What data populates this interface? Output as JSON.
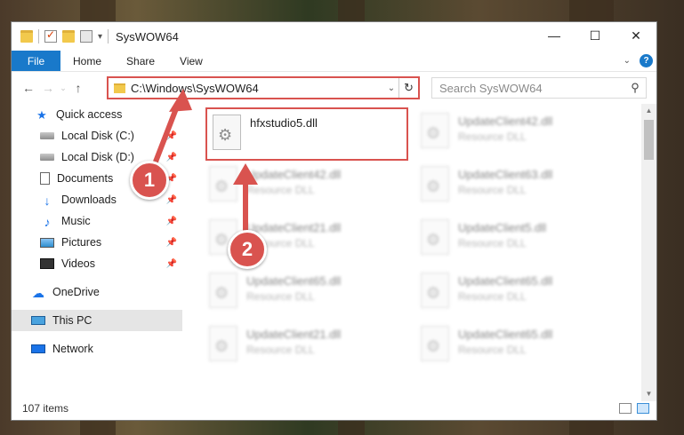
{
  "window": {
    "title": "SysWOW64"
  },
  "ribbon": {
    "tabs": [
      "File",
      "Home",
      "Share",
      "View"
    ],
    "help": "?"
  },
  "address": {
    "path": "C:\\Windows\\SysWOW64",
    "refresh_icon": "refresh-icon"
  },
  "search": {
    "placeholder": "Search SysWOW64"
  },
  "sidebar": {
    "items": [
      {
        "label": "Quick access",
        "icon": "star-icon",
        "pinned": false
      },
      {
        "label": "Local Disk (C:)",
        "icon": "disk-icon",
        "pinned": true
      },
      {
        "label": "Local Disk (D:)",
        "icon": "disk-icon",
        "pinned": true
      },
      {
        "label": "Documents",
        "icon": "document-icon",
        "pinned": true
      },
      {
        "label": "Downloads",
        "icon": "download-icon",
        "pinned": true
      },
      {
        "label": "Music",
        "icon": "music-icon",
        "pinned": true
      },
      {
        "label": "Pictures",
        "icon": "pictures-icon",
        "pinned": true
      },
      {
        "label": "Videos",
        "icon": "video-icon",
        "pinned": true
      },
      {
        "label": "OneDrive",
        "icon": "cloud-icon",
        "pinned": false
      },
      {
        "label": "This PC",
        "icon": "pc-icon",
        "pinned": false,
        "selected": true
      },
      {
        "label": "Network",
        "icon": "network-icon",
        "pinned": false
      }
    ]
  },
  "files": [
    {
      "name": "hfxstudio5.dll",
      "type": ""
    },
    {
      "name": "UpdateClient42.dll",
      "type": "Resource DLL"
    },
    {
      "name": "UpdateClient42.dll",
      "type": "Resource DLL"
    },
    {
      "name": "UpdateClient63.dll",
      "type": "Resource DLL"
    },
    {
      "name": "UpdateClient21.dll",
      "type": "Resource DLL"
    },
    {
      "name": "UpdateClient5.dll",
      "type": "Resource DLL"
    },
    {
      "name": "UpdateClient65.dll",
      "type": "Resource DLL"
    },
    {
      "name": "UpdateClient65.dll",
      "type": "Resource DLL"
    },
    {
      "name": "UpdateClient21.dll",
      "type": "Resource DLL"
    },
    {
      "name": "UpdateClient65.dll",
      "type": "Resource DLL"
    }
  ],
  "status": {
    "item_count": "107 items"
  },
  "annotations": {
    "step1": "1",
    "step2": "2",
    "color": "#d9534f"
  }
}
